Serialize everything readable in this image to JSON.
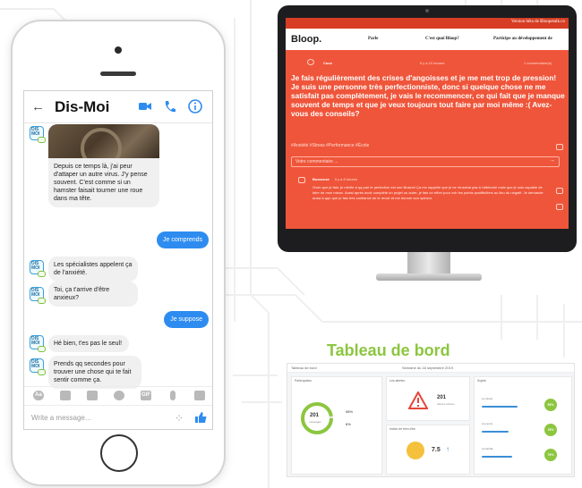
{
  "messenger": {
    "title": "Dis-Moi",
    "avatar_text": "DIS\nMOI",
    "messages": [
      {
        "from": "bot",
        "text": "Depuis ce temps là, j'ai peur d'attaper un autre virus. J'y pense souvent. C'est comme si un hamster faisait tourner une roue dans ma tête."
      },
      {
        "from": "user",
        "text": "Je comprends"
      },
      {
        "from": "bot",
        "text": "Les spécialistes appelent ça de l'anxiété."
      },
      {
        "from": "bot",
        "text": "Toi, ça t'arrive d'être anxieux?"
      },
      {
        "from": "user",
        "text": "Je suppose"
      },
      {
        "from": "bot",
        "text": "Hé bien, t'es pas le seul!"
      },
      {
        "from": "bot",
        "text": "Prends qq secondes pour trouver une chose qui te fait sentir comme ça."
      }
    ],
    "input_placeholder": "Write a message...",
    "toolbar": [
      "Aa",
      "camera-icon",
      "image-icon",
      "emoji-icon",
      "GIF",
      "mic-icon",
      "more-icon"
    ],
    "accent_color": "#2e8cf0"
  },
  "website": {
    "beta_text": "Version bêta de Bloopetalk.co",
    "logo": "Bloop.",
    "nav": [
      "Parle",
      "C'est quoi Bloop?",
      "Participe au développement de"
    ],
    "post": {
      "author": "Coco",
      "time": "Il y a 10 heures",
      "comments": "1 commentaire(s)",
      "title": "Je fais régulièrement des crises d'angoisses et je me met trop de pression! Je suis une personne très perfectionniste, donc si quelque chose ne me satisfait pas complètement, je vais le recommencer, ce qui fait que je manque souvent de temps et que je veux toujours tout faire par moi même :( Avez-vous des conseils?",
      "tags": "#Anxiété #Stress #Performance #École",
      "comment_placeholder": "Votre commentaire ..."
    },
    "reply": {
      "author": "Bosseuse",
      "time": "Il y a 8 heures",
      "text": "Gosh que je fais: je mérite à qq part le perfection est une illusion! Ça me rappelle que je ne réussirai pas à l'atteindre mais que je suis capable de faire de mon mieux. Aussi après avoir complété un projet ou autre, je fais un effort pour voir les points positifs/tiers au lieu du négatif. Je demande aussi à qqn que je fais très confiance de le revoir et me donner son opinion."
    },
    "background_color": "#ef553a"
  },
  "dashboard": {
    "heading": "Tableau de bord",
    "top_left": "Tableau de bord",
    "top_mid": "Semaine du 16 septembre 2019",
    "panels": {
      "participation": {
        "label": "Participation",
        "center": "201",
        "center_sub": "messages",
        "stat1": "98%",
        "stat2": "8%"
      },
      "alerts": {
        "label": "Les alertes",
        "value": "201",
        "sub": "Alertes actives"
      },
      "mood": {
        "label": "Indice de bien-être",
        "value": "7.5"
      },
      "right": {
        "label": "Sujets",
        "rows": [
          "Le stress",
          "Les amis",
          "La famille"
        ],
        "badges": [
          "95%",
          "76%",
          "79%"
        ]
      }
    },
    "accent_color": "#8cc63f"
  }
}
